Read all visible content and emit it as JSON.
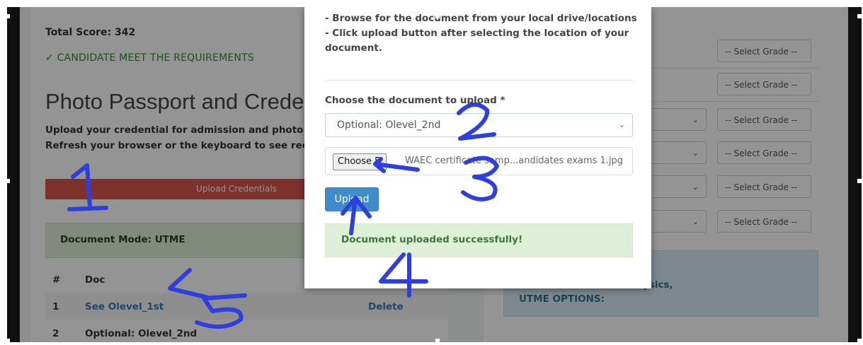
{
  "background_page": {
    "total_score": "Total Score: 342",
    "requirement_status": "✓ CANDIDATE MEET THE REQUIREMENTS",
    "section_title": "Photo Passport and Creden",
    "instructions": "Upload your credential for admission and photo p red button below: Note: Refresh your browser or the keyboard to see recent upload.",
    "upload_credentials_label": "Upload Credentials",
    "document_mode": "Document Mode: UTME",
    "table": {
      "headers": [
        "#",
        "Doc"
      ],
      "rows": [
        {
          "num": "1",
          "doc": "See Olevel_1st",
          "action": "Delete"
        },
        {
          "num": "2",
          "doc": "Optional: Olevel_2nd"
        }
      ]
    }
  },
  "grade_panel": {
    "grade_selects": [
      "-- Select Grade --",
      "-- Select Grade --",
      "-- Select Grade --",
      "-- Select Grade --",
      "-- Select Grade --",
      "-- Select Grade --"
    ],
    "info_line1": "ysics,",
    "info_line2": "UTME OPTIONS:"
  },
  "modal": {
    "instruction_lines": [
      "- Browse for the document from your local drive/locations",
      "- Click upload button after selecting the location of your document."
    ],
    "choose_label": "Choose the document to upload *",
    "selected_document": "Optional: Olevel_2nd",
    "file_button": "Choose Fi",
    "file_name": "WAEC certificate samp...andidates exams 1.jpg",
    "upload_button": "Upload",
    "success_message": "Document uploaded successfully!"
  },
  "annotations": [
    "1",
    "2",
    "3",
    "4",
    "5"
  ],
  "colors": {
    "danger": "#d9534f",
    "primary": "#428bca",
    "success_bg": "#dff0d8",
    "info_bg": "#d9edf7",
    "annotation_ink": "#2f3fdc"
  }
}
